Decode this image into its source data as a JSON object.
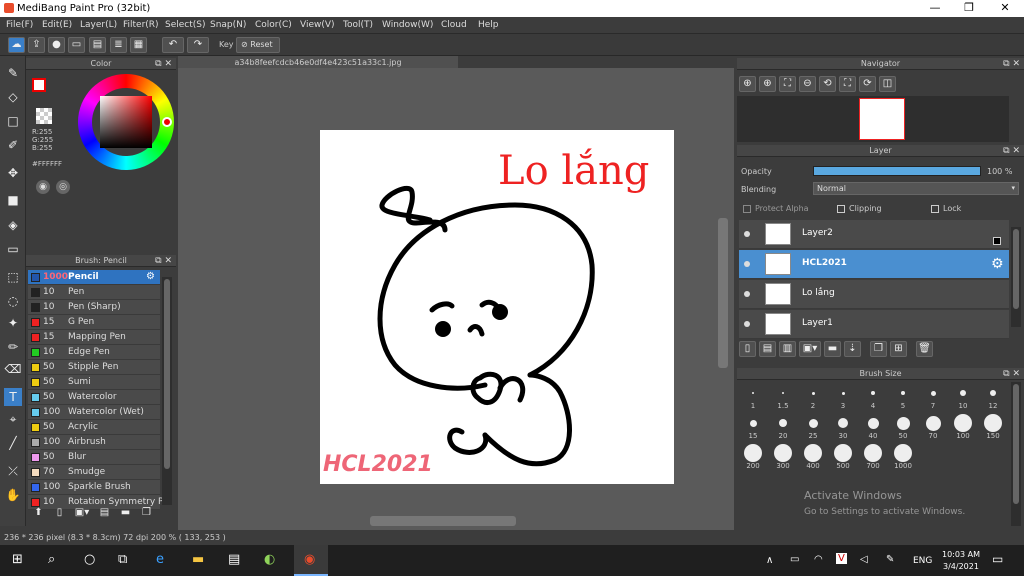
{
  "window": {
    "title": "MediBang Paint Pro (32bit)"
  },
  "menu": [
    "File(F)",
    "Edit(E)",
    "Layer(L)",
    "Filter(R)",
    "Select(S)",
    "Snap(N)",
    "Color(C)",
    "View(V)",
    "Tool(T)",
    "Window(W)",
    "Cloud",
    "Help"
  ],
  "toolbar": {
    "key_label": "Key",
    "reset_label": "Reset"
  },
  "doc_tab": "a34b8feefcdcb46e0df4e423c51a33c1.jpg",
  "color_panel": {
    "title": "Color",
    "r": "R:255",
    "g": "G:255",
    "b": "B:255",
    "hex": "#FFFFFF"
  },
  "brush_panel": {
    "title": "Brush: Pencil",
    "items": [
      {
        "size": "1000",
        "name": "Pencil",
        "color": "#2255aa"
      },
      {
        "size": "10",
        "name": "Pen",
        "color": "#222222"
      },
      {
        "size": "10",
        "name": "Pen (Sharp)",
        "color": "#222222"
      },
      {
        "size": "15",
        "name": "G Pen",
        "color": "#ee2222"
      },
      {
        "size": "15",
        "name": "Mapping Pen",
        "color": "#ee2222"
      },
      {
        "size": "10",
        "name": "Edge Pen",
        "color": "#22cc22"
      },
      {
        "size": "50",
        "name": "Stipple Pen",
        "color": "#eecc11"
      },
      {
        "size": "50",
        "name": "Sumi",
        "color": "#eecc11"
      },
      {
        "size": "50",
        "name": "Watercolor",
        "color": "#66ccee"
      },
      {
        "size": "100",
        "name": "Watercolor (Wet)",
        "color": "#66ccee"
      },
      {
        "size": "50",
        "name": "Acrylic",
        "color": "#eecc11"
      },
      {
        "size": "100",
        "name": "Airbrush",
        "color": "#aaaaaa"
      },
      {
        "size": "50",
        "name": "Blur",
        "color": "#ee99ee"
      },
      {
        "size": "70",
        "name": "Smudge",
        "color": "#f5dcc0"
      },
      {
        "size": "100",
        "name": "Sparkle Brush",
        "color": "#3366ee"
      },
      {
        "size": "10",
        "name": "Rotation Symmetry Pe",
        "color": "#ee2222"
      }
    ]
  },
  "navigator": {
    "title": "Navigator"
  },
  "layer_panel": {
    "title": "Layer",
    "opacity_label": "Opacity",
    "opacity_value": "100 %",
    "opacity": 1.0,
    "blending_label": "Blending",
    "blending_value": "Normal",
    "protect_alpha": "Protect Alpha",
    "clipping": "Clipping",
    "lock": "Lock",
    "layers": [
      {
        "name": "Layer2"
      },
      {
        "name": "HCL2021"
      },
      {
        "name": "Lo lắng"
      },
      {
        "name": "Layer1"
      }
    ]
  },
  "brush_size": {
    "title": "Brush Size",
    "sizes": [
      "1",
      "1.5",
      "2",
      "3",
      "4",
      "5",
      "7",
      "10",
      "12",
      "15",
      "20",
      "25",
      "30",
      "40",
      "50",
      "70",
      "100",
      "150",
      "200",
      "300",
      "400",
      "500",
      "700",
      "1000"
    ]
  },
  "canvas_text": {
    "title": "Lo lắng",
    "signature": "HCL2021"
  },
  "status": "236 * 236 pixel  (8.3 * 8.3cm)  72 dpi  200 %  ( 133, 253 )",
  "watermark": {
    "line1": "Activate Windows",
    "line2": "Go to Settings to activate Windows."
  },
  "taskbar": {
    "lang": "ENG",
    "time": "10:03 AM",
    "date": "3/4/2021"
  },
  "colors": {
    "accent": "#4a8fd0",
    "selected_brush": "#2f73c0",
    "canvas_red": "#ee2222"
  }
}
